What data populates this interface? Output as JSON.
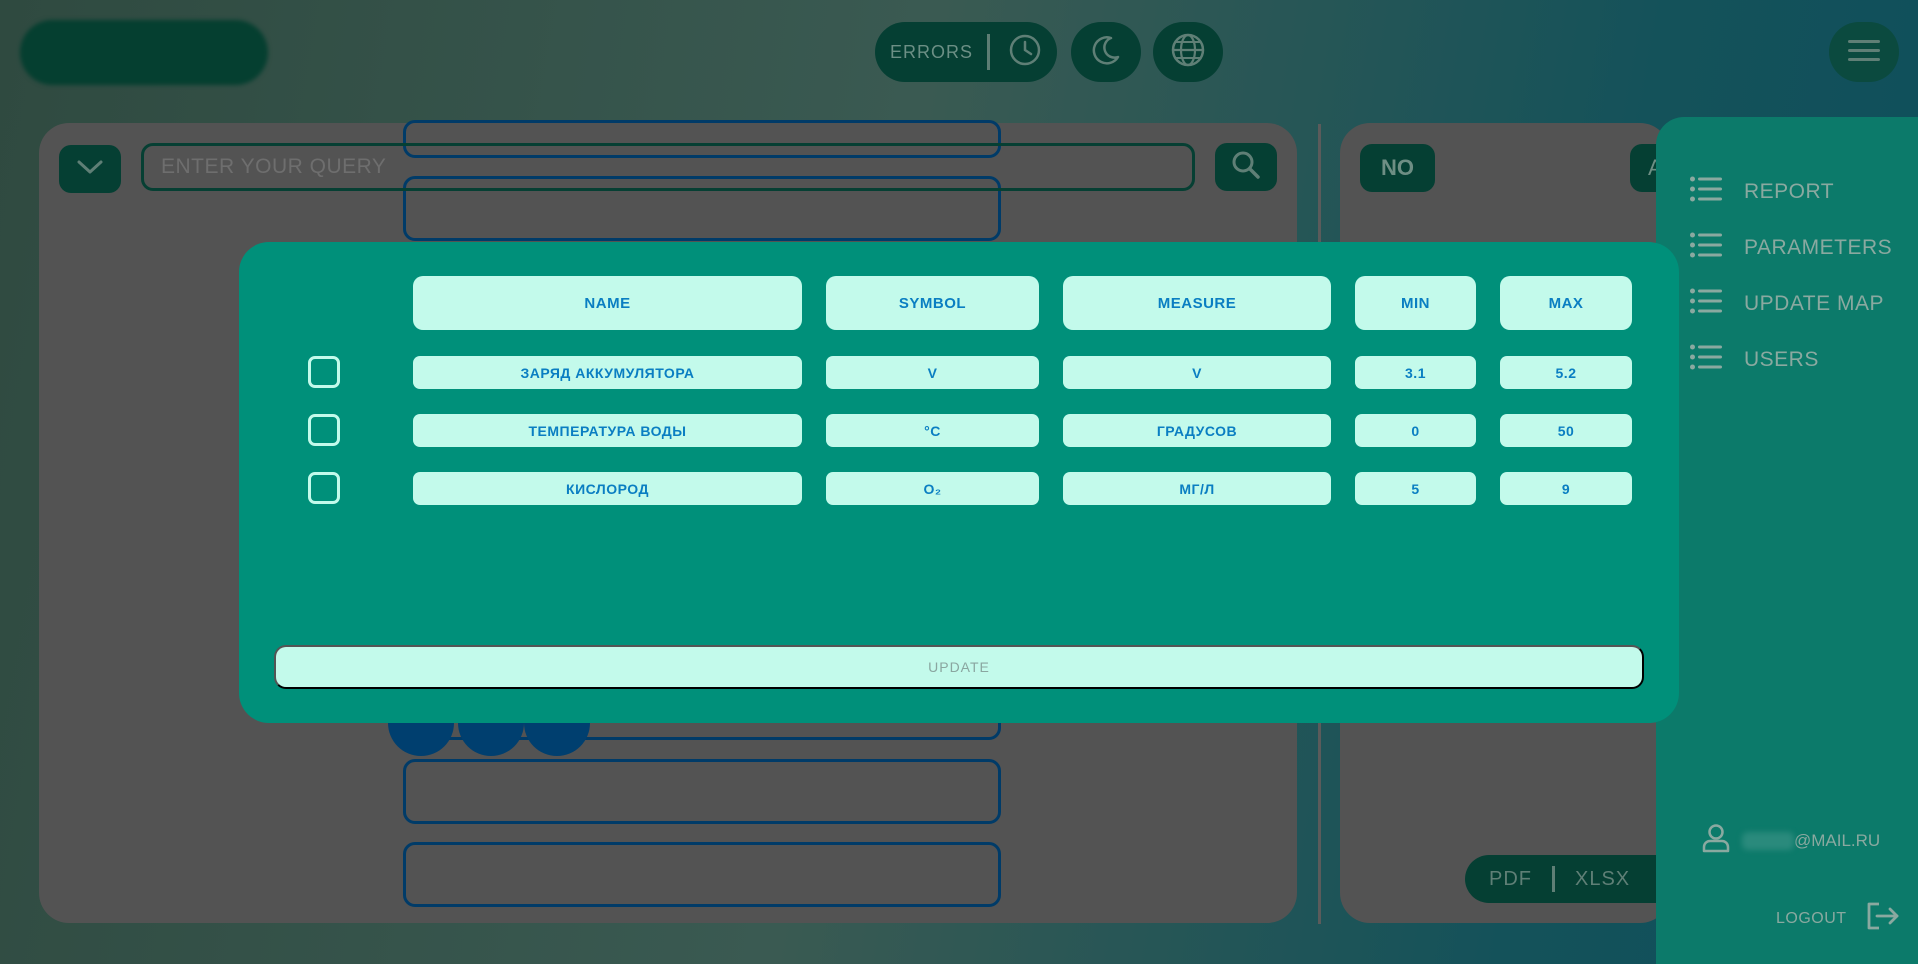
{
  "header": {
    "errors_label": "ERRORS",
    "icons": [
      "clock-icon",
      "moon-icon",
      "globe-icon",
      "hamburger-menu-icon"
    ]
  },
  "search": {
    "placeholder": "ENTER YOUR QUERY"
  },
  "right_panel": {
    "no_label": "NO",
    "a_label": "A",
    "export": [
      "PDF",
      "XLSX"
    ]
  },
  "sidebar": {
    "items": [
      {
        "label": "REPORT"
      },
      {
        "label": "PARAMETERS"
      },
      {
        "label": "UPDATE MAP"
      },
      {
        "label": "USERS"
      }
    ],
    "user_email_suffix": "@MAIL.RU",
    "logout_label": "LOGOUT"
  },
  "modal": {
    "columns": [
      "NAME",
      "SYMBOL",
      "MEASURE",
      "MIN",
      "MAX"
    ],
    "rows": [
      {
        "name": "ЗАРЯД АККУМУЛЯТОРА",
        "symbol": "V",
        "measure": "V",
        "min": "3.1",
        "max": "5.2",
        "checked": false
      },
      {
        "name": "ТЕМПЕРАТУРА ВОДЫ",
        "symbol": "°C",
        "measure": "ГРАДУСОВ",
        "min": "0",
        "max": "50",
        "checked": false
      },
      {
        "name": "КИСЛОРОД",
        "symbol": "O₂",
        "measure": "МГ/Л",
        "min": "5",
        "max": "9",
        "checked": false
      }
    ],
    "update_label": "UPDATE"
  },
  "colors": {
    "modal_bg": "#00907a",
    "cell_bg": "#c3faeb",
    "cell_text": "#0a7ec2",
    "sidebar_bg": "#0c7a6a",
    "dark_button": "#053f33"
  }
}
